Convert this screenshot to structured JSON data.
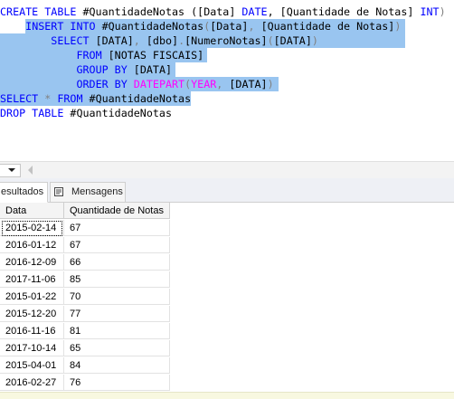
{
  "editor": {
    "lines": [
      [
        {
          "t": "CREATE TABLE ",
          "c": "kw"
        },
        {
          "t": "#QuantidadeNotas (",
          "c": ""
        },
        {
          "t": "[Data] ",
          "c": ""
        },
        {
          "t": "DATE",
          "c": "kw"
        },
        {
          "t": ", [Quantidade de Notas] ",
          "c": ""
        },
        {
          "t": "INT",
          "c": "kw"
        },
        {
          "t": ")",
          "c": "gr"
        }
      ],
      [
        {
          "t": "    ",
          "c": ""
        },
        {
          "t": "INSERT INTO ",
          "c": "kw"
        },
        {
          "t": "#QuantidadeNotas",
          "c": ""
        },
        {
          "t": "(",
          "c": "gr"
        },
        {
          "t": "[Data]",
          "c": ""
        },
        {
          "t": ", ",
          "c": "gr"
        },
        {
          "t": "[Quantidade de Notas]",
          "c": ""
        },
        {
          "t": ")",
          "c": "gr"
        }
      ],
      [
        {
          "t": "        ",
          "c": ""
        },
        {
          "t": "SELECT ",
          "c": "kw"
        },
        {
          "t": "[DATA]",
          "c": ""
        },
        {
          "t": ", ",
          "c": "gr"
        },
        {
          "t": "[dbo]",
          "c": ""
        },
        {
          "t": ".",
          "c": "gr"
        },
        {
          "t": "[NumeroNotas]",
          "c": ""
        },
        {
          "t": "(",
          "c": "gr"
        },
        {
          "t": "[DATA]",
          "c": ""
        },
        {
          "t": ")",
          "c": "gr"
        }
      ],
      [
        {
          "t": "            ",
          "c": ""
        },
        {
          "t": "FROM ",
          "c": "kw"
        },
        {
          "t": "[NOTAS FISCAIS]",
          "c": ""
        }
      ],
      [
        {
          "t": "            ",
          "c": ""
        },
        {
          "t": "GROUP BY ",
          "c": "kw"
        },
        {
          "t": "[DATA]",
          "c": ""
        }
      ],
      [
        {
          "t": "            ",
          "c": ""
        },
        {
          "t": "ORDER BY ",
          "c": "kw"
        },
        {
          "t": "DATEPART",
          "c": "fn"
        },
        {
          "t": "(",
          "c": "gr"
        },
        {
          "t": "YEAR",
          "c": "fn"
        },
        {
          "t": ", ",
          "c": "gr"
        },
        {
          "t": "[DATA]",
          "c": ""
        },
        {
          "t": ")",
          "c": "gr"
        }
      ],
      [
        {
          "t": "SELECT ",
          "c": "kw"
        },
        {
          "t": "* ",
          "c": "gr"
        },
        {
          "t": "FROM ",
          "c": "kw"
        },
        {
          "t": "#QuantidadeNotas",
          "c": ""
        }
      ],
      [
        {
          "t": "DROP TABLE ",
          "c": "kw"
        },
        {
          "t": "#QuantidadeNotas",
          "c": ""
        }
      ]
    ]
  },
  "tabs": {
    "results_label": "esultados",
    "messages_label": "Mensagens"
  },
  "grid": {
    "columns": [
      "Data",
      "Quantidade de Notas"
    ],
    "rows": [
      [
        "2015-02-14",
        "67"
      ],
      [
        "2016-01-12",
        "67"
      ],
      [
        "2016-12-09",
        "66"
      ],
      [
        "2017-11-06",
        "85"
      ],
      [
        "2015-01-22",
        "70"
      ],
      [
        "2015-12-20",
        "77"
      ],
      [
        "2016-11-16",
        "81"
      ],
      [
        "2017-10-14",
        "65"
      ],
      [
        "2015-04-01",
        "84"
      ],
      [
        "2016-02-27",
        "76"
      ]
    ]
  },
  "colors": {
    "keyword": "#0000ff",
    "function": "#ff00ff",
    "operator": "#808080",
    "selection": "#99c5f0"
  }
}
